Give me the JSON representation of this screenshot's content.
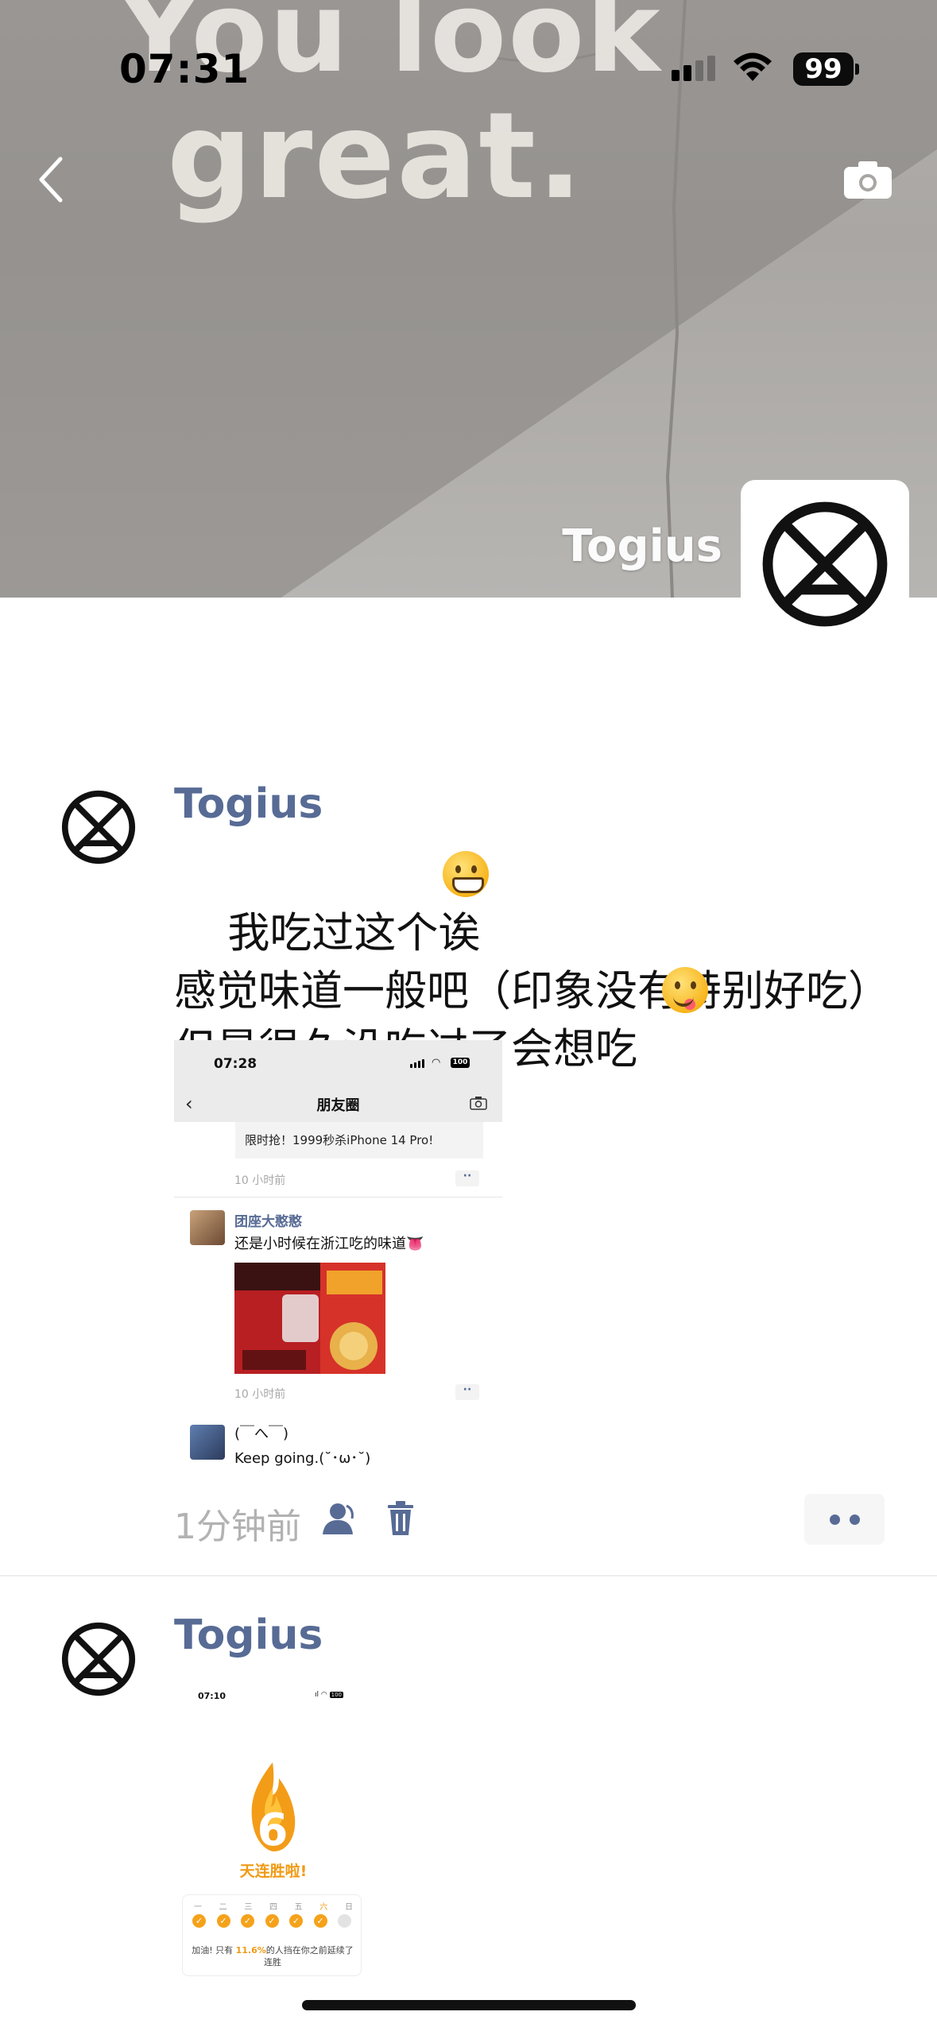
{
  "status_bar": {
    "time": "07:31",
    "battery": "99"
  },
  "cover": {
    "wall_text_1": "You look",
    "wall_text_2": "great.",
    "profile_name": "Togius"
  },
  "post1": {
    "author": "Togius",
    "text": "我吃过这个诶\n感觉味道一般吧（印象没有特别好吃）\n但是很久没吃过了会想吃",
    "emojis": [
      "grin-emoji",
      "yum-emoji"
    ],
    "time": "1分钟前",
    "screenshot": {
      "time": "07:28",
      "battery": "100",
      "title": "朋友圈",
      "ad_text": "限时抢！1999秒杀iPhone 14 Pro!",
      "ad_timestamp": "10 小时前",
      "item1_name": "团座大憨憨",
      "item1_text": "还是小时候在浙江吃的味道👅",
      "item1_timestamp": "10 小时前",
      "item2_name": "(￣へ￣)",
      "item2_text": "Keep going.(˘･ω･˘)"
    }
  },
  "post2": {
    "author": "Togius",
    "screenshot": {
      "time": "07:10",
      "battery": "100",
      "streak_number": "6",
      "streak_text": "天连胜啦!",
      "weekdays": [
        "一",
        "二",
        "三",
        "四",
        "五",
        "六",
        "日"
      ],
      "checked": [
        true,
        true,
        true,
        true,
        true,
        true,
        false
      ],
      "card_text_pre": "加油! 只有",
      "card_pct": "11.6%",
      "card_text_post": "的人挡在你之前延续了连胜"
    }
  },
  "colors": {
    "link": "#576b95",
    "meta_gray": "#b2b2b2",
    "streak_orange": "#f09a14"
  }
}
